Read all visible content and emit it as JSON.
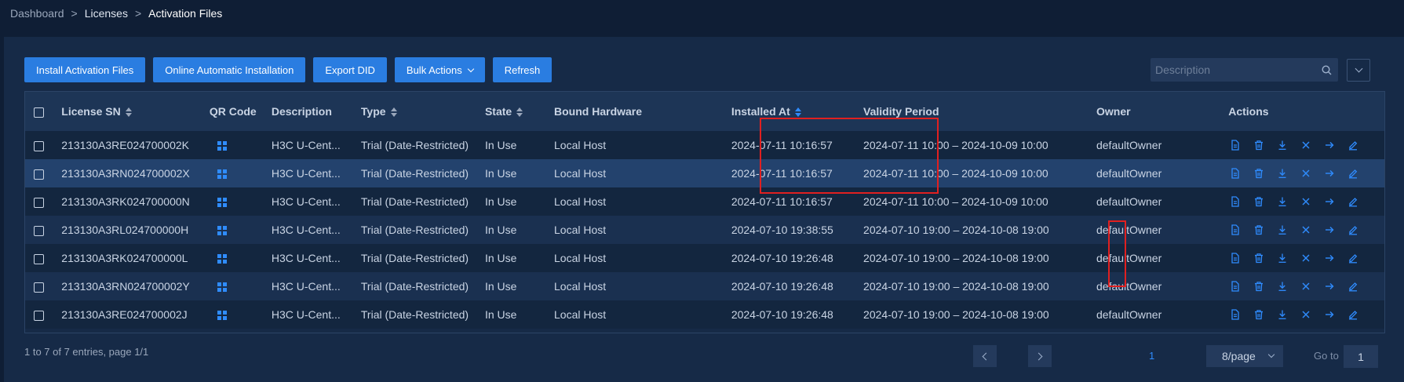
{
  "breadcrumb": {
    "items": [
      "Dashboard",
      "Licenses",
      "Activation Files"
    ],
    "separator": ">"
  },
  "toolbar": {
    "install_label": "Install Activation Files",
    "online_install_label": "Online Automatic Installation",
    "export_did_label": "Export DID",
    "bulk_actions_label": "Bulk Actions",
    "refresh_label": "Refresh"
  },
  "search": {
    "placeholder": "Description",
    "value": ""
  },
  "table": {
    "columns": {
      "license_sn": "License SN",
      "qr_code": "QR Code",
      "description": "Description",
      "type": "Type",
      "state": "State",
      "bound_hardware": "Bound Hardware",
      "installed_at": "Installed At",
      "validity_period": "Validity Period",
      "owner": "Owner",
      "actions": "Actions"
    },
    "rows": [
      {
        "sn": "213130A3RE024700002K",
        "description": "H3C U-Cent...",
        "type": "Trial (Date-Restricted)",
        "state": "In Use",
        "hardware": "Local Host",
        "installed": "2024-07-11 10:16:57",
        "validity": "2024-07-11 10:00 – 2024-10-09 10:00",
        "owner": "defaultOwner"
      },
      {
        "sn": "213130A3RN024700002X",
        "description": "H3C U-Cent...",
        "type": "Trial (Date-Restricted)",
        "state": "In Use",
        "hardware": "Local Host",
        "installed": "2024-07-11 10:16:57",
        "validity": "2024-07-11 10:00 – 2024-10-09 10:00",
        "owner": "defaultOwner"
      },
      {
        "sn": "213130A3RK024700000N",
        "description": "H3C U-Cent...",
        "type": "Trial (Date-Restricted)",
        "state": "In Use",
        "hardware": "Local Host",
        "installed": "2024-07-11 10:16:57",
        "validity": "2024-07-11 10:00 – 2024-10-09 10:00",
        "owner": "defaultOwner"
      },
      {
        "sn": "213130A3RL024700000H",
        "description": "H3C U-Cent...",
        "type": "Trial (Date-Restricted)",
        "state": "In Use",
        "hardware": "Local Host",
        "installed": "2024-07-10 19:38:55",
        "validity": "2024-07-10 19:00 – 2024-10-08 19:00",
        "owner": "defaultOwner"
      },
      {
        "sn": "213130A3RK024700000L",
        "description": "H3C U-Cent...",
        "type": "Trial (Date-Restricted)",
        "state": "In Use",
        "hardware": "Local Host",
        "installed": "2024-07-10 19:26:48",
        "validity": "2024-07-10 19:00 – 2024-10-08 19:00",
        "owner": "defaultOwner"
      },
      {
        "sn": "213130A3RN024700002Y",
        "description": "H3C U-Cent...",
        "type": "Trial (Date-Restricted)",
        "state": "In Use",
        "hardware": "Local Host",
        "installed": "2024-07-10 19:26:48",
        "validity": "2024-07-10 19:00 – 2024-10-08 19:00",
        "owner": "defaultOwner"
      },
      {
        "sn": "213130A3RE024700002J",
        "description": "H3C U-Cent...",
        "type": "Trial (Date-Restricted)",
        "state": "In Use",
        "hardware": "Local Host",
        "installed": "2024-07-10 19:26:48",
        "validity": "2024-07-10 19:00 – 2024-10-08 19:00",
        "owner": "defaultOwner"
      }
    ],
    "action_icons": [
      "document-icon",
      "trash-icon",
      "download-icon",
      "close-icon",
      "arrow-right-icon",
      "edit-icon"
    ]
  },
  "pagination": {
    "summary": "1 to 7 of 7 entries, page 1/1",
    "current_page": "1",
    "per_page": "8/page",
    "goto_label": "Go to",
    "goto_value": "1"
  },
  "colors": {
    "accent": "#2a7de1",
    "icon_blue": "#2f8cff",
    "highlight_red": "#e02020"
  }
}
